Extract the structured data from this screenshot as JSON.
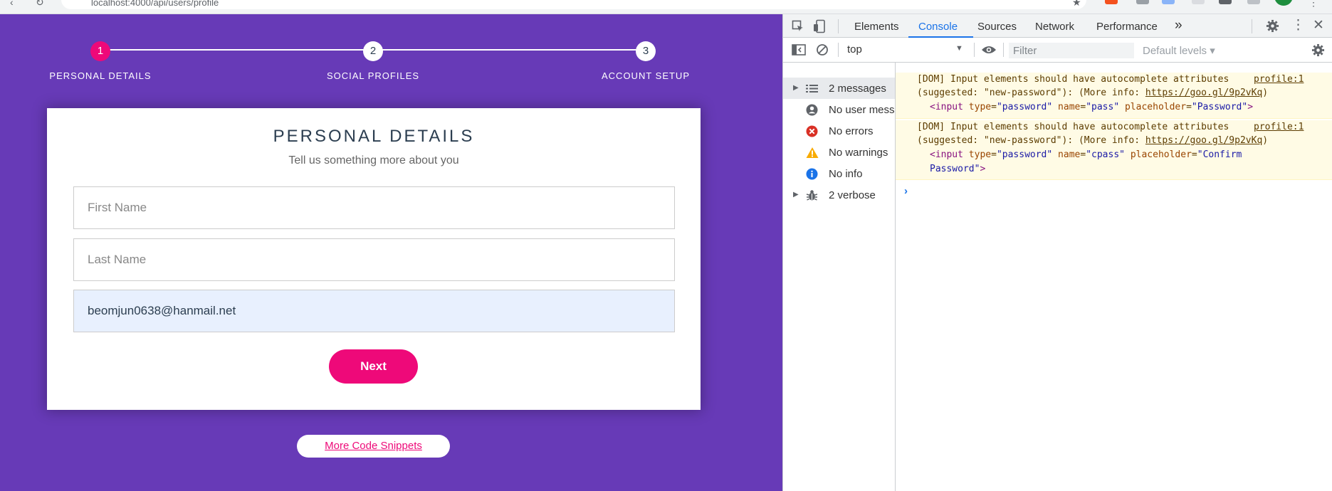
{
  "browser": {
    "url": "localhost:4000/api/users/profile"
  },
  "wizard": {
    "steps": [
      {
        "number": "1",
        "label": "Personal Details"
      },
      {
        "number": "2",
        "label": "Social Profiles"
      },
      {
        "number": "3",
        "label": "Account Setup"
      }
    ],
    "active_step": 1
  },
  "form": {
    "title": "Personal Details",
    "subtitle": "Tell us something more about you",
    "first_name_placeholder": "First Name",
    "last_name_placeholder": "Last Name",
    "email_value": "beomjun0638@hanmail.net",
    "next_label": "Next"
  },
  "footer": {
    "snippets_label": "More Code Snippets"
  },
  "devtools": {
    "tabs": [
      "Elements",
      "Console",
      "Sources",
      "Network",
      "Performance"
    ],
    "active_tab": "Console",
    "more_tabs": "»",
    "context": "top",
    "filter_placeholder": "Filter",
    "levels_label": "Default levels",
    "sidebar": [
      {
        "label": "2 messages",
        "icon": "list-icon",
        "expandable": true
      },
      {
        "label": "No user messages",
        "icon": "user-icon",
        "expandable": false
      },
      {
        "label": "No errors",
        "icon": "error-icon",
        "expandable": false
      },
      {
        "label": "No warnings",
        "icon": "warning-icon",
        "expandable": false
      },
      {
        "label": "No info",
        "icon": "info-icon",
        "expandable": false
      },
      {
        "label": "2 verbose",
        "icon": "bug-icon",
        "expandable": true
      }
    ],
    "messages": [
      {
        "text": "[DOM] Input elements should have autocomplete attributes",
        "source": "profile:1",
        "suggested": "(suggested: \"new-password\"): (More info: ",
        "link": "https://goo.gl/9p2vKq",
        "close": ")",
        "snippet": {
          "tag": "input",
          "type": "password",
          "name": "pass",
          "placeholder": "Password"
        }
      },
      {
        "text": "[DOM] Input elements should have autocomplete attributes",
        "source": "profile:1",
        "suggested": "(suggested: \"new-password\"): (More info: ",
        "link": "https://goo.gl/9p2vKq",
        "close": ")",
        "snippet": {
          "tag": "input",
          "type": "password",
          "name": "cpass",
          "placeholder": "Confirm Password",
          "placeholder_line1": "Confirm",
          "placeholder_line2": "Password"
        }
      }
    ],
    "prompt": "›"
  },
  "colors": {
    "page_bg": "#673ab7",
    "accent": "#ee0979",
    "devtools_blue": "#1a73e8",
    "warning_bg": "#fffbe5"
  }
}
